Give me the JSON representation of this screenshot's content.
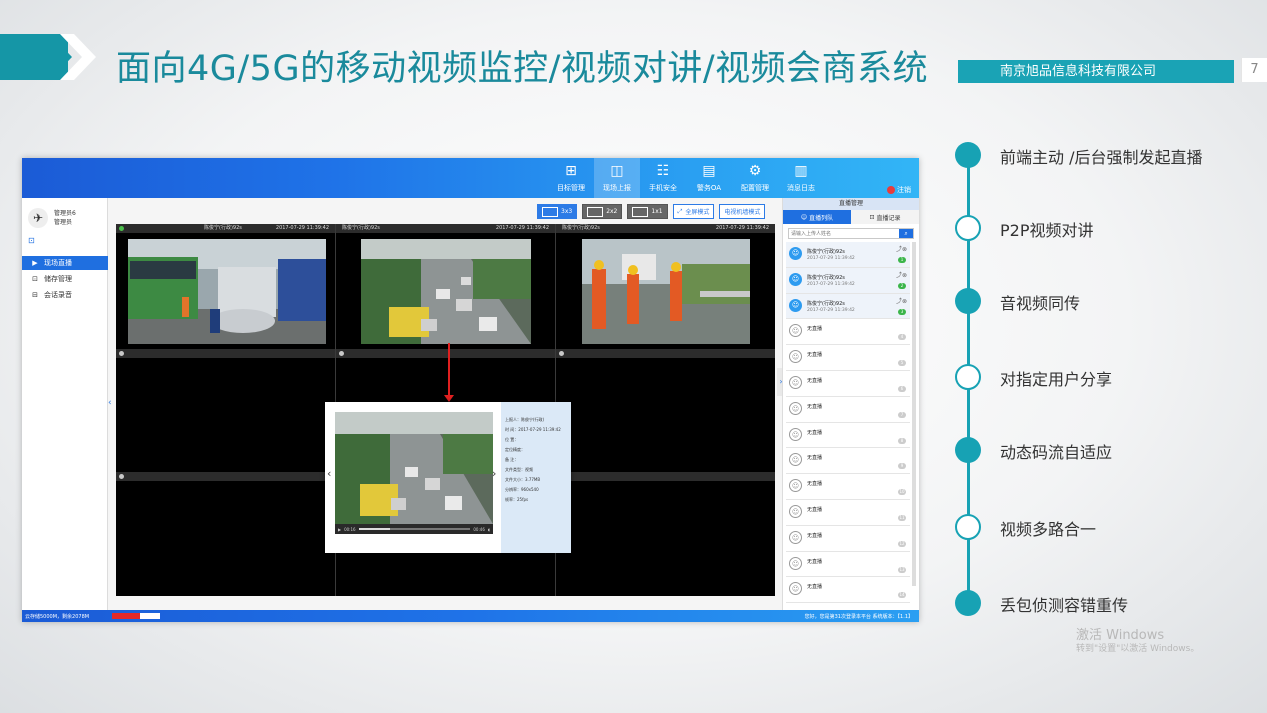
{
  "slide": {
    "title": "面向4G/5G的移动视频监控/视频对讲/视频会商系统",
    "company": "南京旭品信息科技有限公司",
    "page_number": "7",
    "accent_color": "#17a2b4"
  },
  "app": {
    "nav": [
      {
        "label": "目标管理",
        "icon": "grid-icon",
        "glyph": "⊞"
      },
      {
        "label": "现场上报",
        "icon": "camera-icon",
        "glyph": "◫"
      },
      {
        "label": "手机安全",
        "icon": "phone-doc-icon",
        "glyph": "☷"
      },
      {
        "label": "警务OA",
        "icon": "book-icon",
        "glyph": "▤"
      },
      {
        "label": "配置管理",
        "icon": "gear-icon",
        "glyph": "⚙"
      },
      {
        "label": "消息日志",
        "icon": "message-log-icon",
        "glyph": "▥"
      }
    ],
    "logout": "注销",
    "user": {
      "name": "管理员6",
      "role": "管理员"
    },
    "sidebar_menu": [
      {
        "label": "现场直播",
        "icon": "live-icon",
        "glyph": "▶"
      },
      {
        "label": "储存管理",
        "icon": "storage-icon",
        "glyph": "⊡"
      },
      {
        "label": "会话录音",
        "icon": "record-icon",
        "glyph": "⊟"
      }
    ],
    "toolbar": {
      "layout_3x3": "3x3",
      "layout_2x2": "2x2",
      "layout_1x1": "1x1",
      "fullscreen": "全屏模式",
      "tv_wall": "电视机墙模式"
    },
    "video_cells": [
      {
        "name": "陈俊宁(行政)92s",
        "time": "2017-07-29 11:39:42"
      },
      {
        "name": "陈俊宁(行政)92s",
        "time": "2017-07-29 11:39:42"
      },
      {
        "name": "陈俊宁(行政)92s",
        "time": "2017-07-29 11:39:42"
      }
    ],
    "popup": {
      "time_left": "00:16",
      "time_right": "00:46",
      "progress": 0.28,
      "info_lines": [
        "上报人：陈俊宁(行政)",
        "时 间：2017-07-29 11:39:42",
        "位 置：",
        "定位精度：",
        "备 注：",
        "文件类型：视频",
        "文件大小：3.77MB",
        "分辨率：960x540",
        "帧率：25fps"
      ]
    },
    "right_panel": {
      "header": "直播管理",
      "tab_live": "直播列队",
      "tab_record": "直播记录",
      "search_placeholder": "请输入上传人姓名",
      "items": [
        {
          "name": "陈俊宁(行政)92s",
          "time": "2017-07-29 11:39:42",
          "badge": "1",
          "online": true
        },
        {
          "name": "陈俊宁(行政)92s",
          "time": "2017-07-29 11:39:42",
          "badge": "2",
          "online": true
        },
        {
          "name": "陈俊宁(行政)92s",
          "time": "2017-07-29 11:39:42",
          "badge": "3",
          "online": true
        },
        {
          "name": "无直播",
          "time": "",
          "badge": "4",
          "online": false
        },
        {
          "name": "无直播",
          "time": "",
          "badge": "5",
          "online": false
        },
        {
          "name": "无直播",
          "time": "",
          "badge": "6",
          "online": false
        },
        {
          "name": "无直播",
          "time": "",
          "badge": "7",
          "online": false
        },
        {
          "name": "无直播",
          "time": "",
          "badge": "8",
          "online": false
        },
        {
          "name": "无直播",
          "time": "",
          "badge": "9",
          "online": false
        },
        {
          "name": "无直播",
          "time": "",
          "badge": "10",
          "online": false
        },
        {
          "name": "无直播",
          "time": "",
          "badge": "11",
          "online": false
        },
        {
          "name": "无直播",
          "time": "",
          "badge": "12",
          "online": false
        },
        {
          "name": "无直播",
          "time": "",
          "badge": "13",
          "online": false
        },
        {
          "name": "无直播",
          "time": "",
          "badge": "14",
          "online": false
        }
      ]
    },
    "status": {
      "storage": "云存储5000M，剩余2078M",
      "storage_used": 0.58,
      "right": "您好，您是第31次登录本平台 系统版本：【1.1】"
    }
  },
  "timeline": [
    {
      "label": "前端主动 /后台强制发起直播",
      "style": "filled"
    },
    {
      "label": "P2P视频对讲",
      "style": "hollow"
    },
    {
      "label": "音视频同传",
      "style": "filled"
    },
    {
      "label": "对指定用户分享",
      "style": "hollow"
    },
    {
      "label": "动态码流自适应",
      "style": "filled"
    },
    {
      "label": "视频多路合一",
      "style": "hollow"
    },
    {
      "label": "丢包侦测容错重传",
      "style": "filled"
    }
  ],
  "watermark": {
    "line1": "激活 Windows",
    "line2": "转到\"设置\"以激活 Windows。"
  }
}
